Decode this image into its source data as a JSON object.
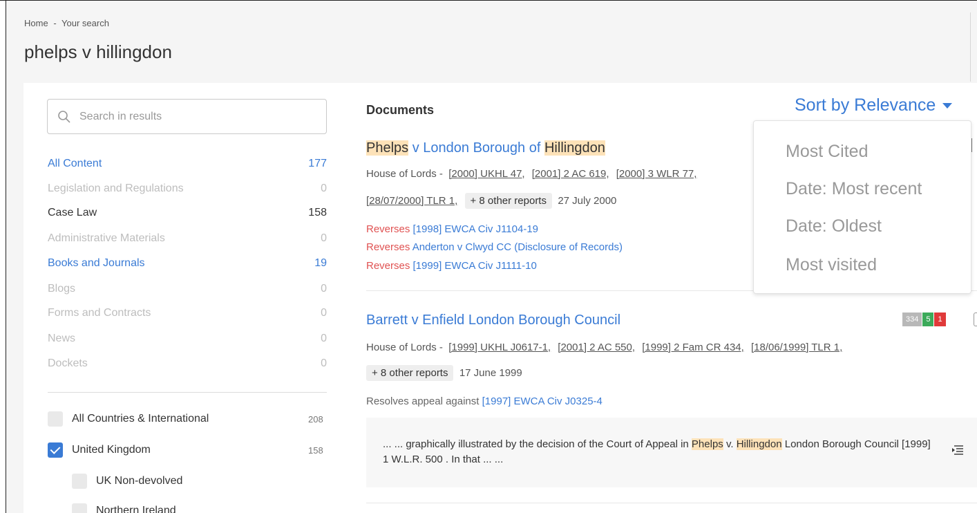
{
  "breadcrumb": {
    "home": "Home",
    "separator": "-",
    "current": "Your search"
  },
  "page_title": "phelps v hillingdon",
  "search": {
    "placeholder": "Search in results",
    "value": "",
    "icon": "search-icon"
  },
  "facets": [
    {
      "label": "All Content",
      "count": "177",
      "state": "active"
    },
    {
      "label": "Legislation and Regulations",
      "count": "0",
      "state": "muted"
    },
    {
      "label": "Case Law",
      "count": "158",
      "state": "dark"
    },
    {
      "label": "Administrative Materials",
      "count": "0",
      "state": "muted"
    },
    {
      "label": "Books and Journals",
      "count": "19",
      "state": "active"
    },
    {
      "label": "Blogs",
      "count": "0",
      "state": "muted"
    },
    {
      "label": "Forms and Contracts",
      "count": "0",
      "state": "muted"
    },
    {
      "label": "News",
      "count": "0",
      "state": "muted"
    },
    {
      "label": "Dockets",
      "count": "0",
      "state": "muted"
    }
  ],
  "countries": [
    {
      "label": "All Countries & International",
      "count": "208",
      "checked": false
    },
    {
      "label": "United Kingdom",
      "count": "158",
      "checked": true
    },
    {
      "label": "UK Non-devolved",
      "count": "",
      "checked": false
    },
    {
      "label": "Northern Ireland",
      "count": "",
      "checked": false
    }
  ],
  "documents_heading": "Documents",
  "sort": {
    "label": "Sort by Relevance",
    "options": [
      "Most Cited",
      "Date: Most recent",
      "Date: Oldest",
      "Most visited"
    ]
  },
  "results": [
    {
      "title_parts": [
        "Phelps",
        " v London Borough of ",
        "Hillingdon"
      ],
      "court": "House of Lords -",
      "refs": [
        "[2000] UKHL 47,",
        "[2001] 2 AC 619,",
        "[2000] 3 WLR 77,",
        "[28/07/2000] TLR 1,"
      ],
      "other_reports": "+ 8 other reports",
      "date": "27 July 2000",
      "relations": [
        {
          "type": "Reverses",
          "target": "[1998] EWCA Civ J1104-19"
        },
        {
          "type": "Reverses",
          "target": "Anderton v Clwyd CC (Disclosure of Records)"
        },
        {
          "type": "Reverses",
          "target": "[1999] EWCA Civ J1111-10"
        }
      ]
    },
    {
      "title": "Barrett v Enfield London Borough Council",
      "court": "House of Lords -",
      "refs": [
        "[1999] UKHL J0617-1,",
        "[2001] 2 AC 550,",
        "[1999] 2 Fam CR 434,",
        "[18/06/1999] TLR 1,"
      ],
      "other_reports": "+ 8 other reports",
      "date": "17 June 1999",
      "badges": [
        "334",
        "5",
        "1"
      ],
      "relation": {
        "type": "Resolves appeal against",
        "target": "[1997] EWCA Civ J0325-4"
      },
      "snippet": {
        "prefix": "... ... graphically illustrated by the decision of the Court of Appeal in ",
        "hl1": "Phelps",
        "mid": " v. ",
        "hl2": "Hillingdon",
        "suffix": " London Borough Council [1999] 1 W.L.R. 500 . In that ... ..."
      }
    }
  ],
  "colors": {
    "accent": "#3a7bd5",
    "highlight": "#fde2b8",
    "relation_red": "#e05252",
    "badge_green": "#3caa5a",
    "badge_red": "#e03a3a"
  }
}
